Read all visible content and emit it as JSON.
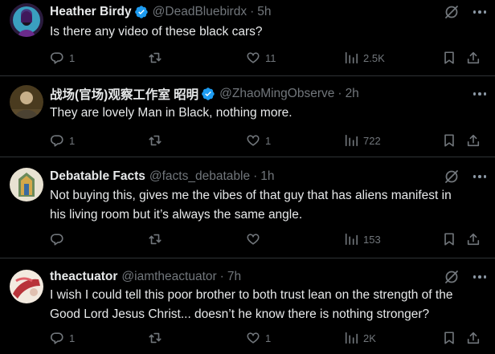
{
  "tweets": [
    {
      "name": "Heather Birdy",
      "handle": "@DeadBluebirdx",
      "dot": "·",
      "time": "5h",
      "text": [
        "Is there any video of these black cars?"
      ],
      "replies": "1",
      "retweets": "",
      "likes": "11",
      "views": "2.5K",
      "verified": true
    },
    {
      "name": "战场(官场)观察工作室 昭明",
      "handle": "@ZhaoMingObserve",
      "dot": "·",
      "time": "2h",
      "text": [
        "They are lovely Man in Black, nothing more."
      ],
      "replies": "1",
      "retweets": "",
      "likes": "1",
      "views": "722",
      "verified": true
    },
    {
      "name": "Debatable Facts",
      "handle": "@facts_debatable",
      "dot": "·",
      "time": "1h",
      "text": [
        "Not buying this, gives me the vibes of that guy that has aliens manifest in",
        "his living room but it’s always the same angle."
      ],
      "replies": "",
      "retweets": "",
      "likes": "",
      "views": "153",
      "verified": false
    },
    {
      "name": "theactuator",
      "handle": "@iamtheactuator",
      "dot": "·",
      "time": "7h",
      "text": [
        "I wish I could tell this poor brother to both trust lean on the strength of the",
        "Good Lord Jesus Christ... doesn’t he know there is nothing stronger?"
      ],
      "replies": "1",
      "retweets": "",
      "likes": "1",
      "views": "2K",
      "verified": false
    }
  ],
  "icons": {
    "reply": "reply-icon",
    "retweet": "retweet-icon",
    "like": "heart-icon",
    "views": "views-icon",
    "bookmark": "bookmark-icon",
    "share": "share-icon",
    "grok": "grok-icon",
    "more": "more-icon",
    "verified": "verified-badge-icon"
  },
  "colors": {
    "background": "#000000",
    "text": "#e7e9ea",
    "muted": "#71767b",
    "verified": "#1d9bf0",
    "divider": "#2f3336"
  }
}
